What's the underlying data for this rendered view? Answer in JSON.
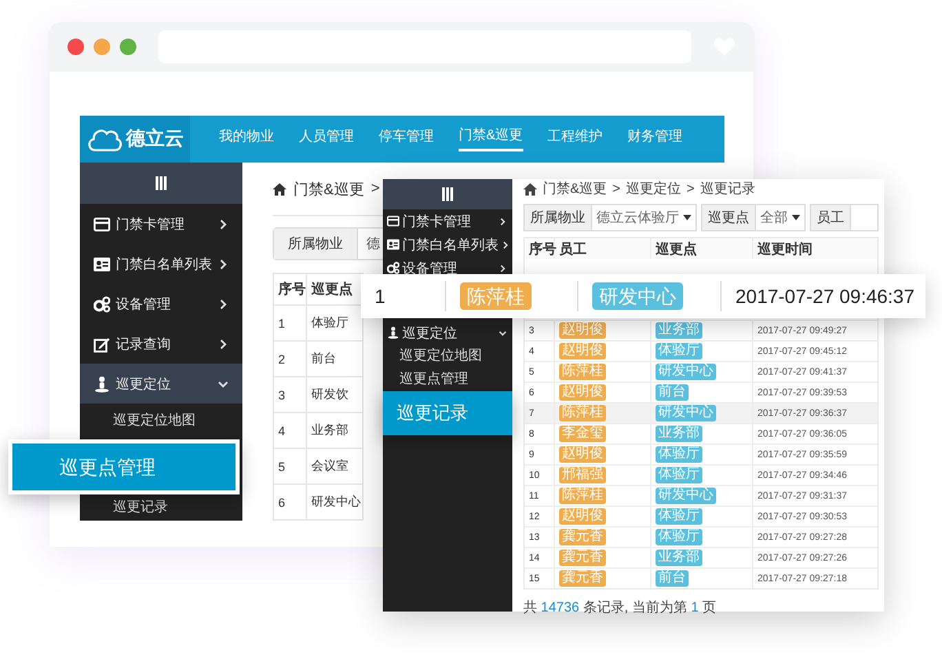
{
  "browser": {
    "dots": [
      {
        "color": "#f44a4a"
      },
      {
        "color": "#f5a54a"
      },
      {
        "color": "#62b346"
      }
    ]
  },
  "main_app": {
    "brand": "德立云",
    "nav": [
      {
        "label": "我的物业",
        "selected": false
      },
      {
        "label": "人员管理",
        "selected": false
      },
      {
        "label": "停车管理",
        "selected": false
      },
      {
        "label": "门禁&巡更",
        "selected": true
      },
      {
        "label": "工程维护",
        "selected": false
      },
      {
        "label": "财务管理",
        "selected": false
      }
    ],
    "sidebar": {
      "items": [
        {
          "label": "门禁卡管理",
          "kind": "card",
          "expanded": false,
          "selected": false
        },
        {
          "label": "门禁白名单列表",
          "kind": "idcard",
          "expanded": false,
          "selected": false
        },
        {
          "label": "设备管理",
          "kind": "gears",
          "expanded": false,
          "selected": false
        },
        {
          "label": "记录查询",
          "kind": "edit",
          "expanded": false,
          "selected": false
        },
        {
          "label": "巡更定位",
          "kind": "person",
          "expanded": true,
          "selected": true,
          "children": [
            {
              "label": "巡更定位地图",
              "selected": false
            },
            {
              "label": "巡更点管理",
              "selected": true
            },
            {
              "label": "巡更记录",
              "selected": false
            }
          ]
        }
      ]
    },
    "breadcrumb": [
      "门禁&巡更",
      ">"
    ],
    "filter": {
      "label": "所属物业",
      "value": "德"
    },
    "table": {
      "columns": [
        "序号",
        "巡更点"
      ],
      "rows": [
        [
          "1",
          "体验厅"
        ],
        [
          "2",
          "前台"
        ],
        [
          "3",
          "研发饮"
        ],
        [
          "4",
          "业务部"
        ],
        [
          "5",
          "会议室"
        ],
        [
          "6",
          "研发中心"
        ]
      ]
    }
  },
  "record_panel": {
    "sidebar": {
      "items": [
        {
          "label": "门禁卡管理",
          "kind": "card",
          "expanded": false,
          "selected": false
        },
        {
          "label": "门禁白名单列表",
          "kind": "idcard",
          "expanded": false,
          "selected": false
        },
        {
          "label": "设备管理",
          "kind": "gears",
          "expanded": false,
          "selected": false
        },
        {
          "label": "巡更定位",
          "kind": "person",
          "expanded": true,
          "selected": false,
          "children": [
            {
              "label": "巡更定位地图",
              "selected": false
            },
            {
              "label": "巡更点管理",
              "selected": false
            },
            {
              "label": "巡更记录",
              "selected": true
            }
          ]
        }
      ]
    },
    "breadcrumb": [
      "门禁&巡更",
      ">",
      "巡更定位",
      ">",
      "巡更记录"
    ],
    "filters": [
      {
        "kind": "select",
        "label": "所属物业",
        "value": "德立云体验厅"
      },
      {
        "kind": "select",
        "label": "巡更点",
        "value": "全部"
      },
      {
        "kind": "input",
        "label": "员工"
      }
    ],
    "table": {
      "columns": [
        "序号",
        "员工",
        "巡更点",
        "巡更时间"
      ],
      "rows": [
        {
          "index": "3",
          "employee": "赵明俊",
          "checkpoint": "业务部",
          "time": "2017-07-27 09:49:27",
          "selected": false
        },
        {
          "index": "4",
          "employee": "赵明俊",
          "checkpoint": "体验厅",
          "time": "2017-07-27 09:45:12",
          "selected": false
        },
        {
          "index": "5",
          "employee": "陈萍桂",
          "checkpoint": "研发中心",
          "time": "2017-07-27 09:41:37",
          "selected": false
        },
        {
          "index": "6",
          "employee": "赵明俊",
          "checkpoint": "前台",
          "time": "2017-07-27 09:39:53",
          "selected": false
        },
        {
          "index": "7",
          "employee": "陈萍桂",
          "checkpoint": "研发中心",
          "time": "2017-07-27 09:36:37",
          "selected": true
        },
        {
          "index": "8",
          "employee": "李金玺",
          "checkpoint": "业务部",
          "time": "2017-07-27 09:36:05",
          "selected": false
        },
        {
          "index": "9",
          "employee": "赵明俊",
          "checkpoint": "体验厅",
          "time": "2017-07-27 09:35:59",
          "selected": false
        },
        {
          "index": "10",
          "employee": "邢福强",
          "checkpoint": "体验厅",
          "time": "2017-07-27 09:34:46",
          "selected": false
        },
        {
          "index": "11",
          "employee": "陈萍桂",
          "checkpoint": "研发中心",
          "time": "2017-07-27 09:31:37",
          "selected": false
        },
        {
          "index": "12",
          "employee": "赵明俊",
          "checkpoint": "体验厅",
          "time": "2017-07-27 09:30:53",
          "selected": false
        },
        {
          "index": "13",
          "employee": "龚元香",
          "checkpoint": "体验厅",
          "time": "2017-07-27 09:27:28",
          "selected": false
        },
        {
          "index": "14",
          "employee": "龚元香",
          "checkpoint": "业务部",
          "time": "2017-07-27 09:27:26",
          "selected": false
        },
        {
          "index": "15",
          "employee": "龚元香",
          "checkpoint": "前台",
          "time": "2017-07-27 09:27:18",
          "selected": false
        }
      ]
    },
    "footer": [
      {
        "kind": "plain",
        "text": "共 "
      },
      {
        "kind": "number",
        "text": "14736"
      },
      {
        "kind": "plain",
        "text": " 条记录, 当前为第 "
      },
      {
        "kind": "number",
        "text": "1"
      },
      {
        "kind": "plain",
        "text": " 页"
      }
    ]
  },
  "highlight_row": {
    "index": "1",
    "employee": "陈萍桂",
    "checkpoint": "研发中心",
    "time": "2017-07-27 09:46:37"
  }
}
